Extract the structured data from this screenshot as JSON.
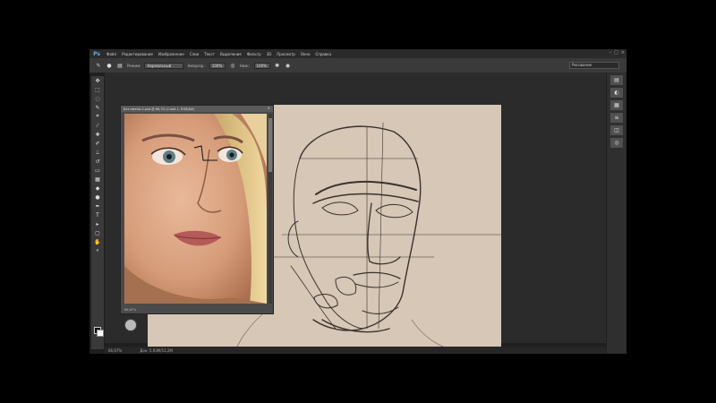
{
  "app": {
    "logo": "Ps",
    "menu": [
      "Файл",
      "Редактирование",
      "Изображение",
      "Слои",
      "Текст",
      "Выделение",
      "Фильтр",
      "3D",
      "Просмотр",
      "Окно",
      "Справка"
    ],
    "window_controls": [
      "–",
      "□",
      "×"
    ]
  },
  "options": {
    "mode_label": "Режим:",
    "mode_value": "Нормальный",
    "opacity_label": "Непрозр.:",
    "opacity_value": "100%",
    "flow_label": "Наж.:",
    "flow_value": "100%",
    "workspace": "Рисование"
  },
  "reference": {
    "title": "Без имени-2.psd @ 66,7% (Слой 1, RGB/8#)",
    "zoom": "66,67%",
    "close": "×"
  },
  "status": {
    "zoom": "66,67%",
    "doc": "Док: 5,93M/11,2M"
  },
  "icons": {
    "tools": [
      "move-icon",
      "marquee-icon",
      "lasso-icon",
      "quick-select-icon",
      "crop-icon",
      "eyedropper-icon",
      "healing-icon",
      "brush-icon",
      "stamp-icon",
      "history-brush-icon",
      "eraser-icon",
      "gradient-icon",
      "blur-icon",
      "dodge-icon",
      "pen-icon",
      "type-icon",
      "path-select-icon",
      "shape-icon",
      "hand-icon",
      "zoom-icon"
    ],
    "panels": [
      "history-icon",
      "color-icon",
      "swatches-icon",
      "adjustments-icon",
      "layers-icon",
      "channels-icon"
    ]
  },
  "colors": {
    "canvas": "#d6c7b6",
    "sketch_line": "#3a322d",
    "ui_dark": "#1f1f1f"
  }
}
